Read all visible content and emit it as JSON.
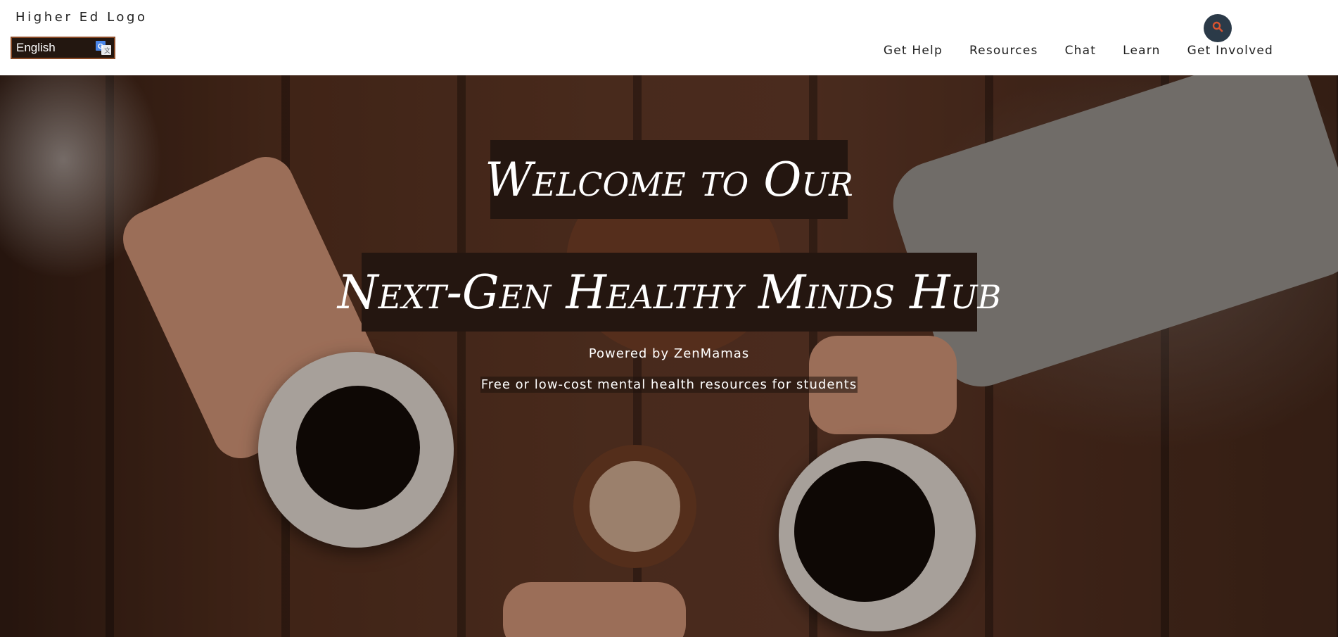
{
  "header": {
    "logo_text": "Higher Ed Logo",
    "language": {
      "selected": "English",
      "icon": "google-translate-icon"
    },
    "search_icon": "search-icon",
    "nav": [
      {
        "label": "Get Help"
      },
      {
        "label": "Resources"
      },
      {
        "label": "Chat"
      },
      {
        "label": "Learn"
      },
      {
        "label": "Get Involved"
      }
    ]
  },
  "hero": {
    "title_line1": "Welcome to Our",
    "title_line2": "Next-Gen Healthy Minds Hub",
    "powered_by": "Powered by ZenMamas",
    "tagline": "Free or low-cost mental health resources for students",
    "background": "coffee-table-hands-photo"
  },
  "colors": {
    "accent": "#d9532f",
    "search_bg": "#2b3a48",
    "title_bg": "#241610",
    "lang_bg": "#231710",
    "lang_border": "#8a4a26"
  }
}
